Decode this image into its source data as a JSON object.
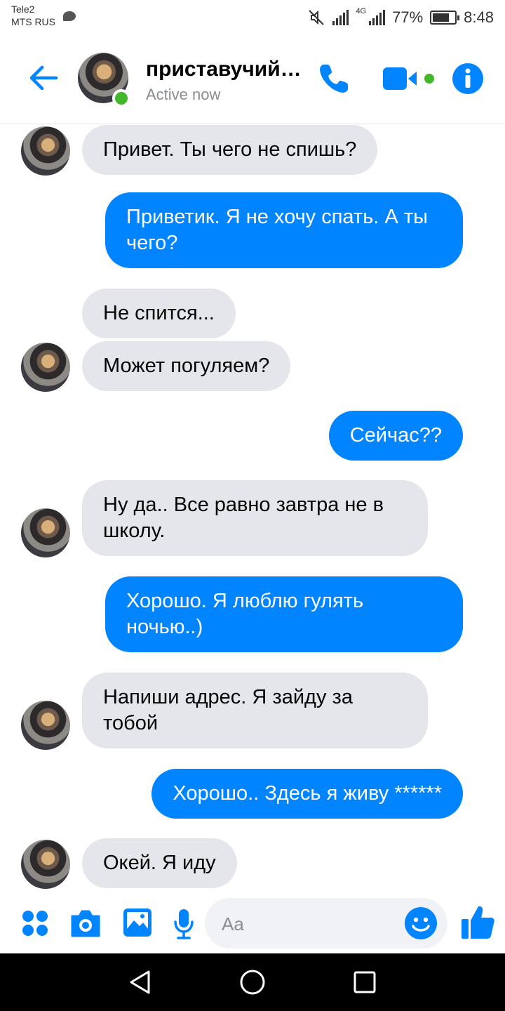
{
  "status_bar": {
    "carrier_line1": "Tele2",
    "carrier_line2": "MTS RUS",
    "network": "4G",
    "battery": "77%",
    "battery_level": 0.77,
    "time": "8:48"
  },
  "header": {
    "contact_name": "приставучий…",
    "status": "Active now",
    "icons": [
      "back-arrow-icon",
      "phone-icon",
      "video-camera-icon",
      "info-icon"
    ],
    "accent_color": "#0084ff",
    "online_color": "#42b72a"
  },
  "messages": [
    {
      "from": "contact",
      "text": "Привет. Ты чего не спишь?"
    },
    {
      "from": "me",
      "text": "Приветик. Я не хочу спать. А ты чего?"
    },
    {
      "from": "contact",
      "text": "Не спится..."
    },
    {
      "from": "contact",
      "text": "Может погуляем?"
    },
    {
      "from": "me",
      "text": "Сейчас??"
    },
    {
      "from": "contact",
      "text": "Ну да.. Все равно завтра не в школу."
    },
    {
      "from": "me",
      "text": "Хорошо. Я люблю гулять ночью..)"
    },
    {
      "from": "contact",
      "text": "Напиши адрес. Я зайду за тобой"
    },
    {
      "from": "me",
      "text": "Хорошо.. Здесь я живу ******"
    },
    {
      "from": "contact",
      "text": "Окей. Я иду"
    }
  ],
  "composer": {
    "placeholder": "Aa",
    "icons": [
      "apps-icon",
      "camera-icon",
      "gallery-icon",
      "microphone-icon",
      "emoji-icon",
      "thumbs-up-icon"
    ]
  },
  "nav": {
    "icons": [
      "back-triangle-icon",
      "home-circle-icon",
      "recents-square-icon"
    ]
  },
  "colors": {
    "incoming_bubble": "#e4e6eb",
    "outgoing_bubble": "#0084ff"
  }
}
